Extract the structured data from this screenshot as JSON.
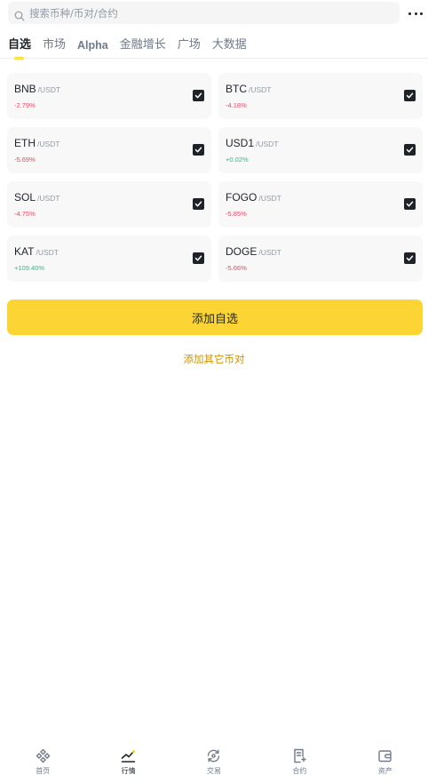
{
  "search": {
    "placeholder": "搜索币种/币对/合约",
    "icon": "search-icon"
  },
  "header": {
    "more_icon": "more-dots-icon"
  },
  "tabs": [
    {
      "label": "自选",
      "active": true
    },
    {
      "label": "市场",
      "active": false
    },
    {
      "label": "Alpha",
      "active": false
    },
    {
      "label": "金融增长",
      "active": false
    },
    {
      "label": "广场",
      "active": false
    },
    {
      "label": "大数据",
      "active": false
    }
  ],
  "pairs": [
    {
      "symbol": "BNB",
      "quote": "/USDT",
      "change": "-2.79%",
      "direction": "down",
      "checked": true
    },
    {
      "symbol": "BTC",
      "quote": "/USDT",
      "change": "-4.18%",
      "direction": "down",
      "checked": true
    },
    {
      "symbol": "ETH",
      "quote": "/USDT",
      "change": "-5.69%",
      "direction": "down",
      "checked": true
    },
    {
      "symbol": "USD1",
      "quote": "/USDT",
      "change": "+0.02%",
      "direction": "up",
      "checked": true
    },
    {
      "symbol": "SOL",
      "quote": "/USDT",
      "change": "-4.75%",
      "direction": "down",
      "checked": true
    },
    {
      "symbol": "FOGO",
      "quote": "/USDT",
      "change": "-5.85%",
      "direction": "down",
      "checked": true
    },
    {
      "symbol": "KAT",
      "quote": "/USDT",
      "change": "+109.40%",
      "direction": "up",
      "checked": true
    },
    {
      "symbol": "DOGE",
      "quote": "/USDT",
      "change": "-5.66%",
      "direction": "down",
      "checked": true
    }
  ],
  "actions": {
    "add_button": "添加自选",
    "add_other_link": "添加其它币对"
  },
  "bottom_nav": [
    {
      "label": "首页",
      "icon": "home-diamond-icon",
      "active": false
    },
    {
      "label": "行情",
      "icon": "market-chart-icon",
      "active": true
    },
    {
      "label": "交易",
      "icon": "trade-exchange-icon",
      "active": false
    },
    {
      "label": "合约",
      "icon": "futures-document-icon",
      "active": false
    },
    {
      "label": "资产",
      "icon": "wallet-icon",
      "active": false
    }
  ],
  "colors": {
    "accent": "#fcd535",
    "negative": "#f6465d",
    "positive": "#2ebd85",
    "link": "#c99400"
  }
}
